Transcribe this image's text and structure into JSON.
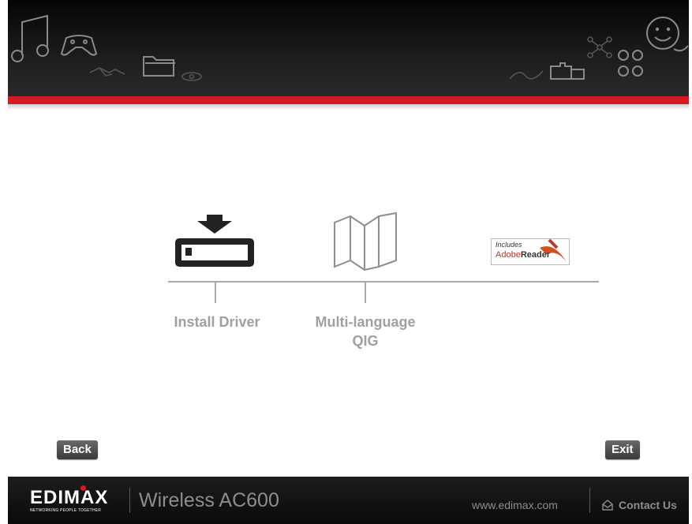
{
  "main": {
    "items": [
      {
        "label_line1": "Install Driver",
        "label_line2": ""
      },
      {
        "label_line1": "Multi-language",
        "label_line2": "QIG"
      }
    ],
    "adobe_badge": {
      "line1": "Includes",
      "brand": "Adobe",
      "product": "Reader"
    }
  },
  "buttons": {
    "back": "Back",
    "exit": "Exit"
  },
  "footer": {
    "brand": "EDIMAX",
    "tagline": "NETWORKING PEOPLE TOGETHER",
    "product": "Wireless AC600",
    "website": "www.edimax.com",
    "contact": "Contact Us"
  },
  "colors": {
    "accent_red": "#d71921",
    "header_bg": "#111111",
    "label_gray": "#a0a0a0"
  },
  "icons": {
    "header": [
      "music-icon",
      "gamepad-icon",
      "handshake-icon",
      "folder-icon",
      "eye-icon",
      "signature-icon",
      "puzzle-icon",
      "network-icon",
      "people-icon",
      "smiley-icon"
    ],
    "items": [
      "download-drive-icon",
      "folded-map-icon",
      "adobe-reader-icon"
    ],
    "footer": [
      "mail-icon"
    ]
  }
}
